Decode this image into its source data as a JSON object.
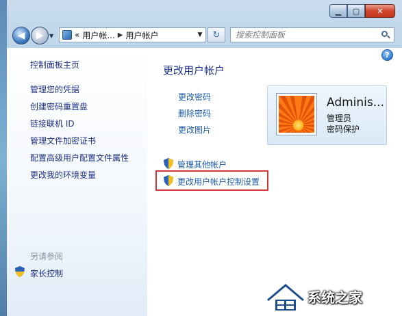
{
  "window": {
    "minimize_icon": "minimize-icon",
    "maximize_icon": "maximize-icon",
    "close_icon": "close-icon"
  },
  "nav": {
    "back_glyph": "◀",
    "forward_glyph": "▶",
    "address_prefix": "«",
    "crumbs": [
      "用户帐...",
      "用户帐户"
    ],
    "crumb_sep": "▶",
    "refresh_glyph": "↻",
    "search_placeholder": "搜索控制面板"
  },
  "sidebar": {
    "home": "控制面板主页",
    "links": [
      "管理您的凭据",
      "创建密码重置盘",
      "链接联机 ID",
      "管理文件加密证书",
      "配置高级用户配置文件属性",
      "更改我的环境变量"
    ],
    "see_also_label": "另请参阅",
    "parental_control": "家长控制"
  },
  "main": {
    "title": "更改用户帐户",
    "tasks": [
      "更改密码",
      "删除密码",
      "更改图片"
    ],
    "admin_tasks": [
      "管理其他帐户",
      "更改用户帐户控制设置"
    ],
    "help": "?"
  },
  "account": {
    "name": "Adminis...",
    "role": "管理员",
    "password_status": "密码保护"
  },
  "watermark": {
    "text": "系统之家"
  },
  "colors": {
    "link": "#1e3287",
    "task_link": "#1e5da8",
    "highlight": "#d23a3a",
    "close_button": "#c2381f"
  }
}
